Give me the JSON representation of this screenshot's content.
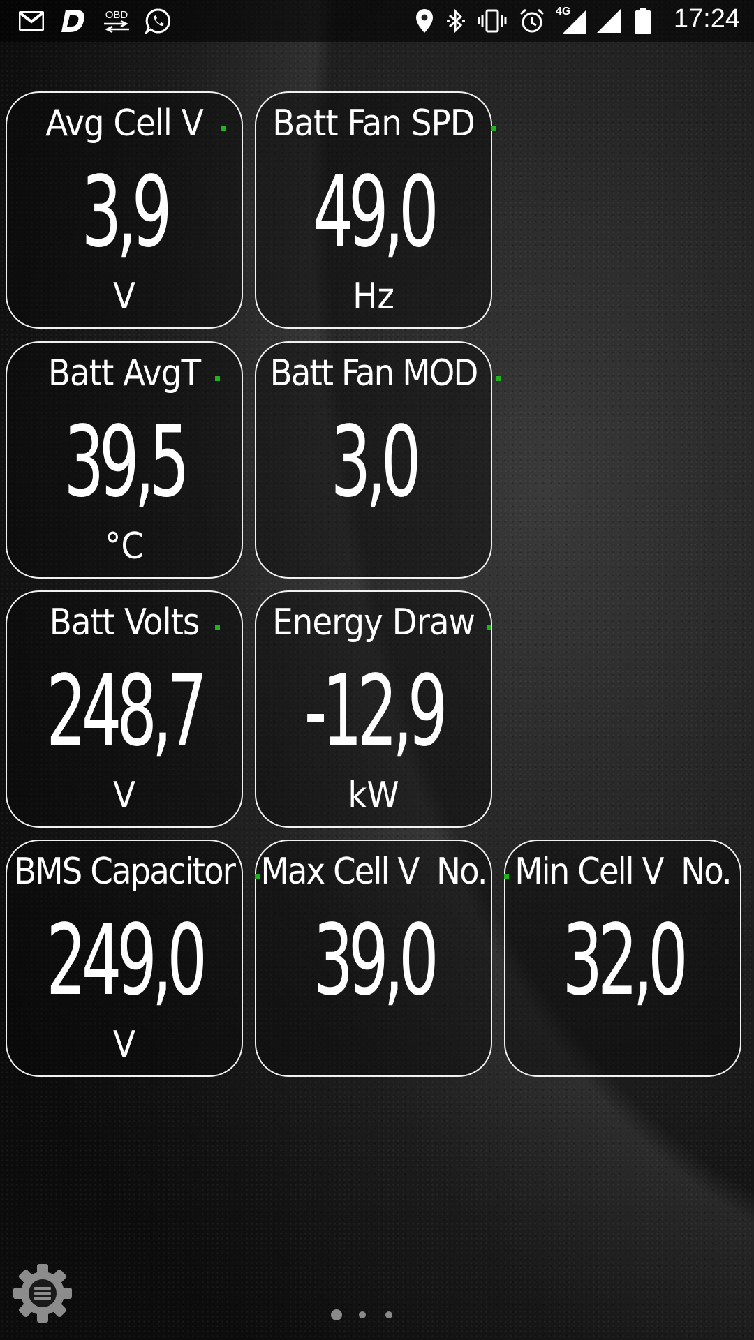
{
  "status_bar": {
    "time": "17:24",
    "network_label": "4G",
    "left_icons": [
      "gmail-icon",
      "dashboard-app-icon",
      "obd-icon",
      "whatsapp-icon"
    ],
    "obd_text": "OBD",
    "right_icons": [
      "location-icon",
      "bluetooth-icon",
      "vibrate-icon",
      "alarm-icon",
      "signal-4g-icon",
      "signal-icon",
      "battery-icon"
    ]
  },
  "gauges": [
    {
      "label": "Avg Cell V",
      "value": "3,9",
      "unit": "V"
    },
    {
      "label": "Batt Fan SPD",
      "value": "49,0",
      "unit": "Hz"
    },
    {
      "label": "Batt AvgT",
      "value": "39,5",
      "unit": "°C"
    },
    {
      "label": "Batt Fan MOD",
      "value": "3,0",
      "unit": ""
    },
    {
      "label": "Batt Volts",
      "value": "248,7",
      "unit": "V"
    },
    {
      "label": "Energy Draw",
      "value": "-12,9",
      "unit": "kW"
    },
    {
      "label": "BMS Capacitor",
      "value": "249,0",
      "unit": "V"
    },
    {
      "label": "Max Cell V  No.",
      "value": "39,0",
      "unit": ""
    },
    {
      "label": "Min Cell V  No.",
      "value": "32,0",
      "unit": ""
    }
  ],
  "pager": {
    "pages": 3,
    "current": 1
  },
  "colors": {
    "tile_border": "#f1f1f1",
    "indicator_green": "#1fb41f",
    "status_bar_bg": "#000000"
  }
}
